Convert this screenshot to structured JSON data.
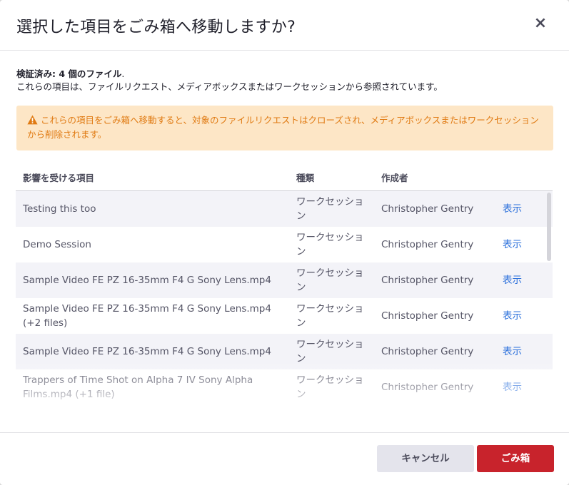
{
  "dialog": {
    "title": "選択した項目をごみ箱へ移動しますか?",
    "close_symbol": "×"
  },
  "summary": {
    "verified_label": "検証済み: ",
    "verified_count": "4 個のファイル",
    "verified_suffix": ".",
    "description": "これらの項目は、ファイルリクエスト、メディアボックスまたはワークセッションから参照されています。"
  },
  "warning": {
    "icon": "warning-triangle-icon",
    "color": "#e07a12",
    "text": "これらの項目をごみ箱へ移動すると、対象のファイルリクエストはクローズされ、メディアボックスまたはワークセッションから削除されます。"
  },
  "table": {
    "headers": [
      "影響を受ける項目",
      "種類",
      "作成者"
    ],
    "rows": [
      {
        "item": "Testing this too",
        "type": "ワークセッション",
        "creator": "Christopher Gentry",
        "action": "表示"
      },
      {
        "item": "Demo Session",
        "type": "ワークセッション",
        "creator": "Christopher Gentry",
        "action": "表示"
      },
      {
        "item": "Sample Video FE PZ 16-35mm F4 G Sony Lens.mp4",
        "type": "ワークセッション",
        "creator": "Christopher Gentry",
        "action": "表示"
      },
      {
        "item": "Sample Video FE PZ 16-35mm F4 G Sony Lens.mp4 (+2 files)",
        "type": "ワークセッション",
        "creator": "Christopher Gentry",
        "action": "表示"
      },
      {
        "item": "Sample Video FE PZ 16-35mm F4 G Sony Lens.mp4",
        "type": "ワークセッション",
        "creator": "Christopher Gentry",
        "action": "表示"
      },
      {
        "item": "Trappers of Time Shot on Alpha 7 IV Sony Alpha Films.mp4 (+1 file)",
        "type": "ワークセッション",
        "creator": "Christopher Gentry",
        "action": "表示"
      }
    ]
  },
  "footer": {
    "cancel_label": "キャンセル",
    "trash_label": "ごみ箱",
    "trash_color": "#c8232c"
  }
}
